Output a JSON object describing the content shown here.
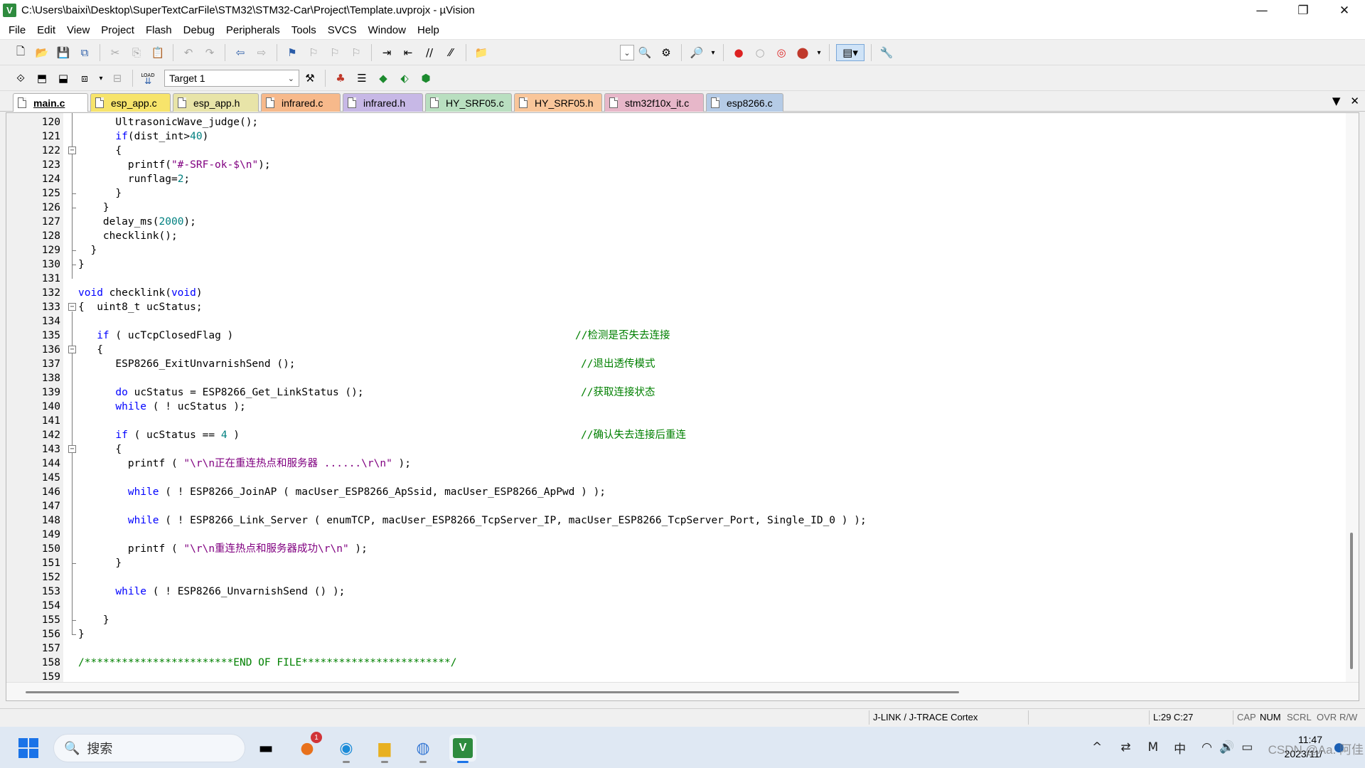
{
  "window": {
    "title": "C:\\Users\\baixi\\Desktop\\SuperTextCarFile\\STM32\\STM32-Car\\Project\\Template.uvprojx - µVision",
    "app_icon": "V",
    "minimize": "—",
    "maximize": "❐",
    "close": "✕"
  },
  "menu": [
    "File",
    "Edit",
    "View",
    "Project",
    "Flash",
    "Debug",
    "Peripherals",
    "Tools",
    "SVCS",
    "Window",
    "Help"
  ],
  "toolbar2": {
    "load_label": "LOAD",
    "target": "Target 1"
  },
  "tabs": [
    {
      "label": "main.c",
      "color": "#f5f5dc"
    },
    {
      "label": "esp_app.c",
      "color": "#f7e46b"
    },
    {
      "label": "esp_app.h",
      "color": "#e8e4a8"
    },
    {
      "label": "infrared.c",
      "color": "#f7b98b"
    },
    {
      "label": "infrared.h",
      "color": "#c7b8e6"
    },
    {
      "label": "HY_SRF05.c",
      "color": "#b9dfc0"
    },
    {
      "label": "HY_SRF05.h",
      "color": "#f9c69a"
    },
    {
      "label": "stm32f10x_it.c",
      "color": "#e7b7c9"
    },
    {
      "label": "esp8266.c",
      "color": "#b5cbe6"
    }
  ],
  "code": {
    "lines": [
      {
        "n": "120",
        "html": "      UltrasonicWave_judge();"
      },
      {
        "n": "121",
        "html": "      <span class='kw'>if</span>(dist_int><span class='num'>40</span>)"
      },
      {
        "n": "122",
        "html": "      {"
      },
      {
        "n": "123",
        "html": "        printf(<span class='str'>\"#-SRF-ok-$\\n\"</span>);"
      },
      {
        "n": "124",
        "html": "        runflag=<span class='num'>2</span>;"
      },
      {
        "n": "125",
        "html": "      }"
      },
      {
        "n": "126",
        "html": "    }"
      },
      {
        "n": "127",
        "html": "    delay_ms(<span class='num'>2000</span>);"
      },
      {
        "n": "128",
        "html": "    checklink();"
      },
      {
        "n": "129",
        "html": "  }"
      },
      {
        "n": "130",
        "html": "}"
      },
      {
        "n": "131",
        "html": ""
      },
      {
        "n": "132",
        "html": "<span class='kw'>void</span> checklink(<span class='kw'>void</span>)"
      },
      {
        "n": "133",
        "html": "{  uint8_t ucStatus;"
      },
      {
        "n": "134",
        "html": ""
      },
      {
        "n": "135",
        "html": "   <span class='kw'>if</span> ( ucTcpClosedFlag )"
      },
      {
        "n": "136",
        "html": "   {"
      },
      {
        "n": "137",
        "html": "      ESP8266_ExitUnvarnishSend ();"
      },
      {
        "n": "138",
        "html": ""
      },
      {
        "n": "139",
        "html": "      <span class='kw'>do</span> ucStatus = ESP8266_Get_LinkStatus ();"
      },
      {
        "n": "140",
        "html": "      <span class='kw'>while</span> ( ! ucStatus );"
      },
      {
        "n": "141",
        "html": ""
      },
      {
        "n": "142",
        "html": "      <span class='kw'>if</span> ( ucStatus == <span class='num'>4</span> )"
      },
      {
        "n": "143",
        "html": "      {"
      },
      {
        "n": "144",
        "html": "        printf ( <span class='str'>\"\\r\\n正在重连热点和服务器 ......\\r\\n\"</span> );"
      },
      {
        "n": "145",
        "html": ""
      },
      {
        "n": "146",
        "html": "        <span class='kw'>while</span> ( ! ESP8266_JoinAP ( macUser_ESP8266_ApSsid, macUser_ESP8266_ApPwd ) );"
      },
      {
        "n": "147",
        "html": ""
      },
      {
        "n": "148",
        "html": "        <span class='kw'>while</span> ( ! ESP8266_Link_Server ( enumTCP, macUser_ESP8266_TcpServer_IP, macUser_ESP8266_TcpServer_Port, Single_ID_0 ) );"
      },
      {
        "n": "149",
        "html": ""
      },
      {
        "n": "150",
        "html": "        printf ( <span class='str'>\"\\r\\n重连热点和服务器成功\\r\\n\"</span> );"
      },
      {
        "n": "151",
        "html": "      }"
      },
      {
        "n": "152",
        "html": ""
      },
      {
        "n": "153",
        "html": "      <span class='kw'>while</span> ( ! ESP8266_UnvarnishSend () );"
      },
      {
        "n": "154",
        "html": ""
      },
      {
        "n": "155",
        "html": "    }"
      },
      {
        "n": "156",
        "html": "}"
      },
      {
        "n": "157",
        "html": ""
      },
      {
        "n": "158",
        "html": "<span class='cmt'>/************************END OF FILE************************/</span>"
      },
      {
        "n": "159",
        "html": ""
      }
    ],
    "comments": [
      {
        "line": 15,
        "text": "//检测是否失去连接"
      },
      {
        "line": 17,
        "text": "//退出透传模式"
      },
      {
        "line": 19,
        "text": "//获取连接状态"
      },
      {
        "line": 22,
        "text": "//确认失去连接后重连"
      }
    ]
  },
  "status": {
    "debugger": "J-LINK / J-TRACE Cortex",
    "position": "L:29 C:27",
    "cap": "CAP",
    "num": "NUM",
    "scrl": "SCRL",
    "ovr": "OVR",
    "rw": "R/W"
  },
  "taskbar": {
    "search_placeholder": "搜索",
    "badge_count": "1",
    "ime": "中",
    "time": "11:47",
    "date": "2023/11/",
    "watermark": "CSDN @Aa. 阿佳"
  },
  "colors": {
    "keyword": "#0000ff",
    "number": "#008080",
    "string": "#800080",
    "comment": "#008000"
  }
}
